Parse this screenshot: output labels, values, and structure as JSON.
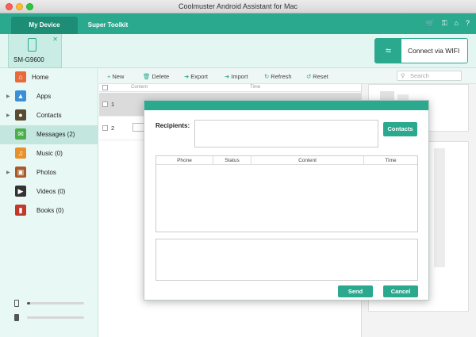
{
  "window": {
    "title": "Coolmuster Android Assistant for Mac"
  },
  "nav": {
    "tabs": [
      {
        "label": "My Device"
      },
      {
        "label": "Super Toolkit"
      }
    ]
  },
  "device": {
    "name": "SM-G9600",
    "wifi_label": "Connect via WIFI"
  },
  "sidebar": {
    "items": [
      {
        "label": "Home"
      },
      {
        "label": "Apps"
      },
      {
        "label": "Contacts"
      },
      {
        "label": "Messages (2)"
      },
      {
        "label": "Music (0)"
      },
      {
        "label": "Photos"
      },
      {
        "label": "Videos (0)"
      },
      {
        "label": "Books (0)"
      }
    ],
    "storage": [
      {
        "used_fraction": 0.05
      },
      {
        "used_fraction": 0.0
      }
    ]
  },
  "toolbar": {
    "new_label": "New",
    "delete_label": "Delete",
    "export_label": "Export",
    "import_label": "Import",
    "refresh_label": "Refresh",
    "reset_label": "Reset",
    "search_placeholder": "Search"
  },
  "list": {
    "columns": [
      "Content",
      "Time"
    ],
    "rows": [
      {
        "num": "1"
      },
      {
        "num": "2"
      }
    ]
  },
  "dialog": {
    "recipients_label": "Recipients:",
    "contacts_button": "Contacts",
    "columns": [
      "Phone",
      "Status",
      "Content",
      "Time"
    ],
    "send_label": "Send",
    "cancel_label": "Cancel"
  },
  "colors": {
    "accent": "#2aa98f",
    "accent_dark": "#1d8d76",
    "sidebar_bg": "#e8f8f5"
  },
  "icons": {
    "top": [
      "cart-icon",
      "key-icon",
      "home-icon",
      "help-icon"
    ]
  }
}
